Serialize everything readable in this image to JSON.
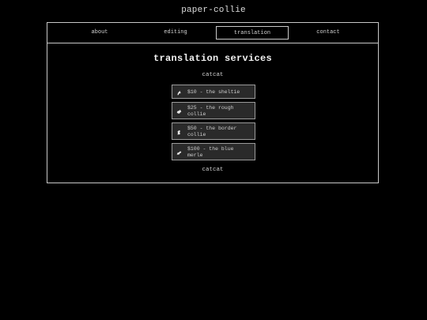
{
  "site": {
    "title": "paper-collie"
  },
  "nav": {
    "items": [
      "about",
      "editing",
      "translation",
      "contact"
    ],
    "active": "translation"
  },
  "main": {
    "heading": "translation services",
    "sub_top": "catcat",
    "sub_bottom": "catcat",
    "options": [
      {
        "label": "$10 - the sheltie",
        "icon": "dog-icon"
      },
      {
        "label": "$25 - the rough collie",
        "icon": "dog-icon"
      },
      {
        "label": "$50 - the border collie",
        "icon": "dog-icon"
      },
      {
        "label": "$100 - the blue merle",
        "icon": "dog-icon"
      }
    ]
  },
  "colors": {
    "background": "#000000",
    "border": "#c8c8c8",
    "button_bg": "#2a2a2a"
  }
}
